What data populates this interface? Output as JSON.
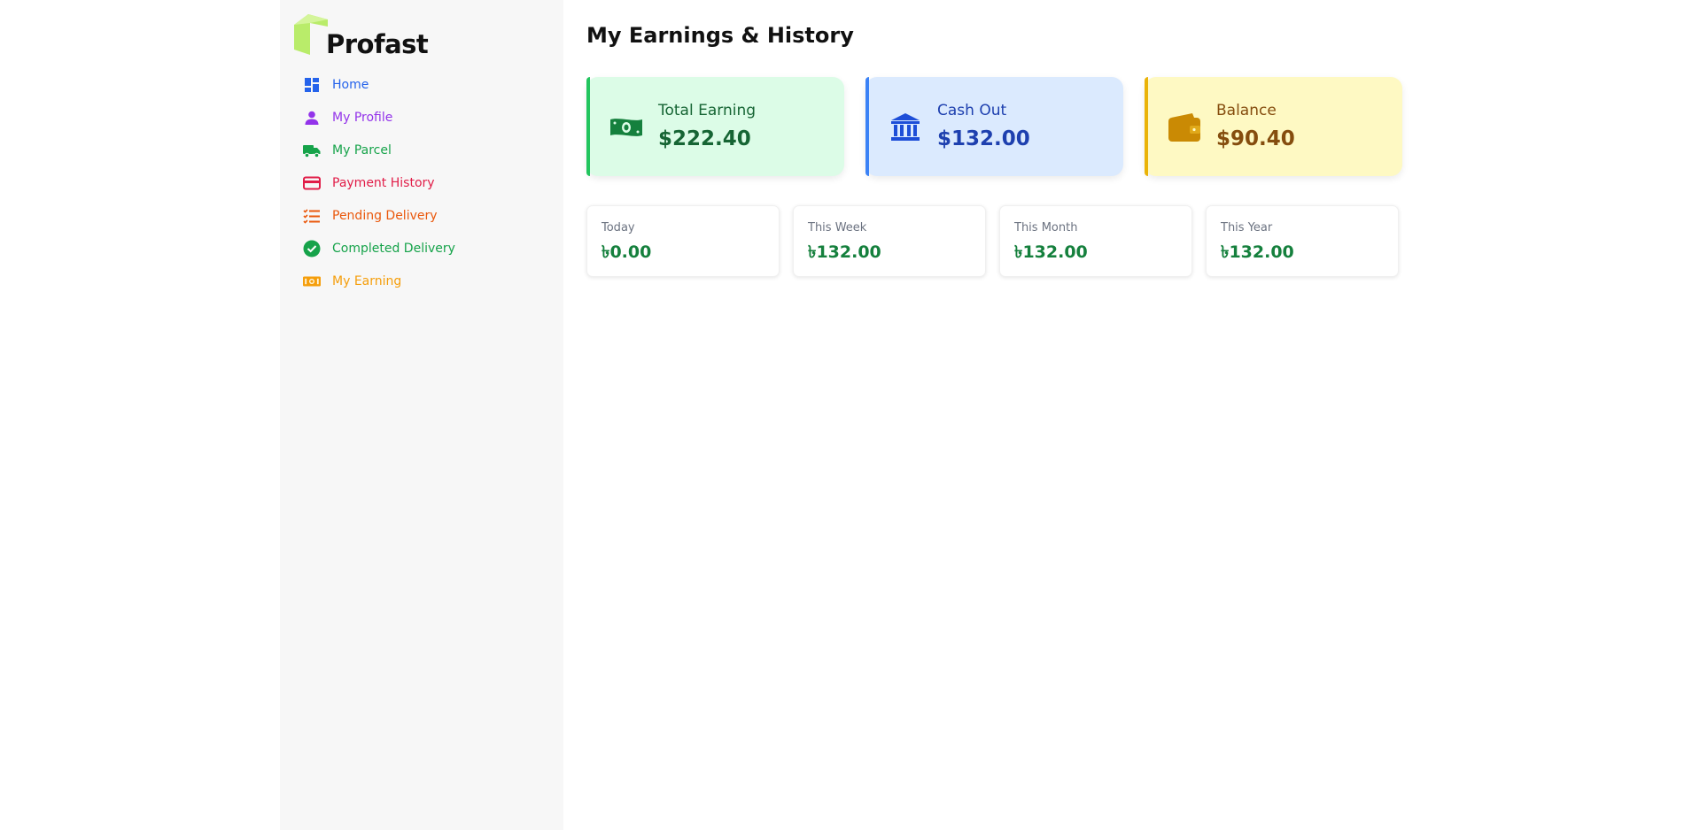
{
  "brand": {
    "name": "Profast",
    "logo_color": "#b9ec6a"
  },
  "sidebar": {
    "items": [
      {
        "label": "Home",
        "icon": "dashboard-icon",
        "color": "#2563eb"
      },
      {
        "label": "My Profile",
        "icon": "person-icon",
        "color": "#9333ea"
      },
      {
        "label": "My Parcel",
        "icon": "truck-icon",
        "color": "#16a34a"
      },
      {
        "label": "Payment History",
        "icon": "credit-card-icon",
        "color": "#e11d48"
      },
      {
        "label": "Pending Delivery",
        "icon": "checklist-icon",
        "color": "#ea580c"
      },
      {
        "label": "Completed Delivery",
        "icon": "check-circle-icon",
        "color": "#16a34a"
      },
      {
        "label": "My Earning",
        "icon": "money-icon",
        "color": "#f59e0b"
      }
    ]
  },
  "main": {
    "title": "My Earnings & History",
    "summary": [
      {
        "label": "Total Earning",
        "value": "$222.40",
        "icon": "banknote-icon",
        "bg": "#dcfce7",
        "accent": "#22c55e",
        "icon_color": "#15803d",
        "text_color": "#166534"
      },
      {
        "label": "Cash Out",
        "value": "$132.00",
        "icon": "bank-icon",
        "bg": "#dbeafe",
        "accent": "#3b82f6",
        "icon_color": "#1d4ed8",
        "text_color": "#1e40af"
      },
      {
        "label": "Balance",
        "value": "$90.40",
        "icon": "wallet-icon",
        "bg": "#fef9c3",
        "accent": "#eab308",
        "icon_color": "#ca8a04",
        "text_color": "#854d0e"
      }
    ],
    "periods": [
      {
        "label": "Today",
        "value": "৳0.00"
      },
      {
        "label": "This Week",
        "value": "৳132.00"
      },
      {
        "label": "This Month",
        "value": "৳132.00"
      },
      {
        "label": "This Year",
        "value": "৳132.00"
      }
    ]
  }
}
